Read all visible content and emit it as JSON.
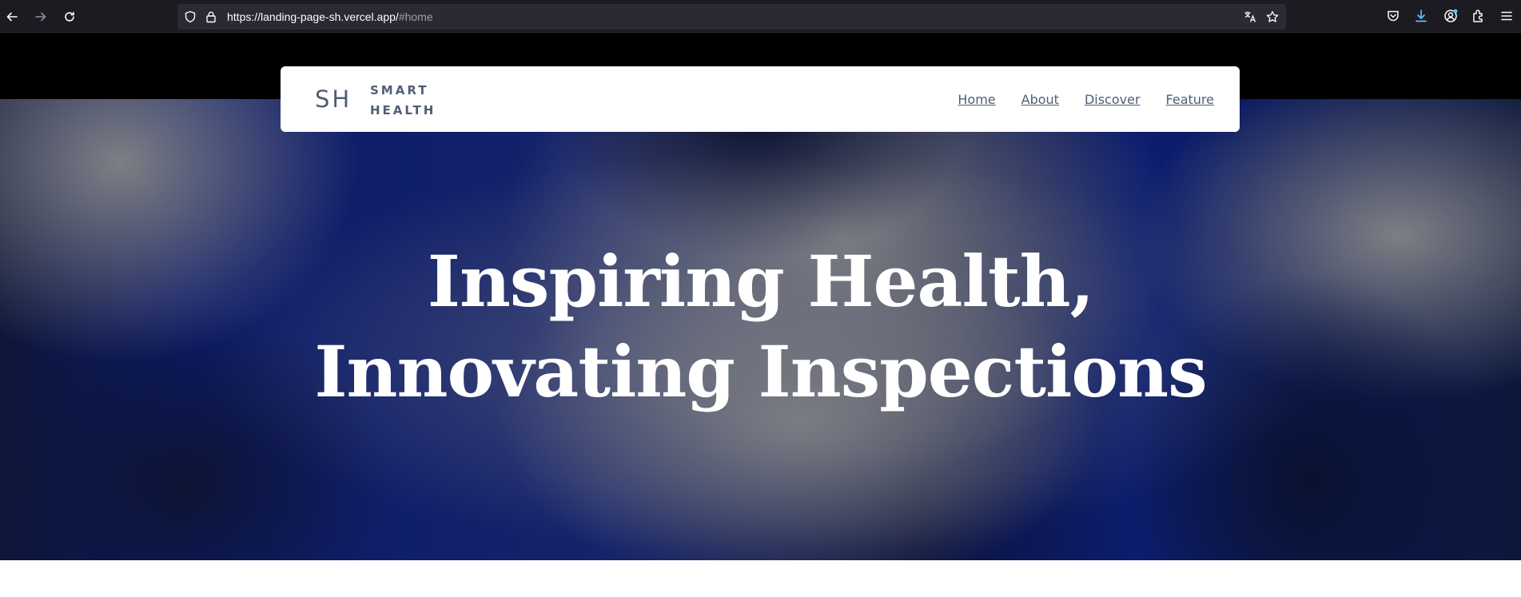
{
  "browser": {
    "url_host": "https://landing-page-sh.vercel.app/",
    "url_hash": "#home"
  },
  "navbar": {
    "logo_mark": "SH",
    "logo_line1": "SMART",
    "logo_line2": "HEALTH",
    "links": [
      "Home",
      "About",
      "Discover",
      "Feature"
    ]
  },
  "hero": {
    "title_line1": "Inspiring Health,",
    "title_line2": "Innovating Inspections"
  },
  "colors": {
    "brand_text": "#4e5f75",
    "hero_blue": "#0b1a6a",
    "browser_bg": "#1c1b22"
  }
}
